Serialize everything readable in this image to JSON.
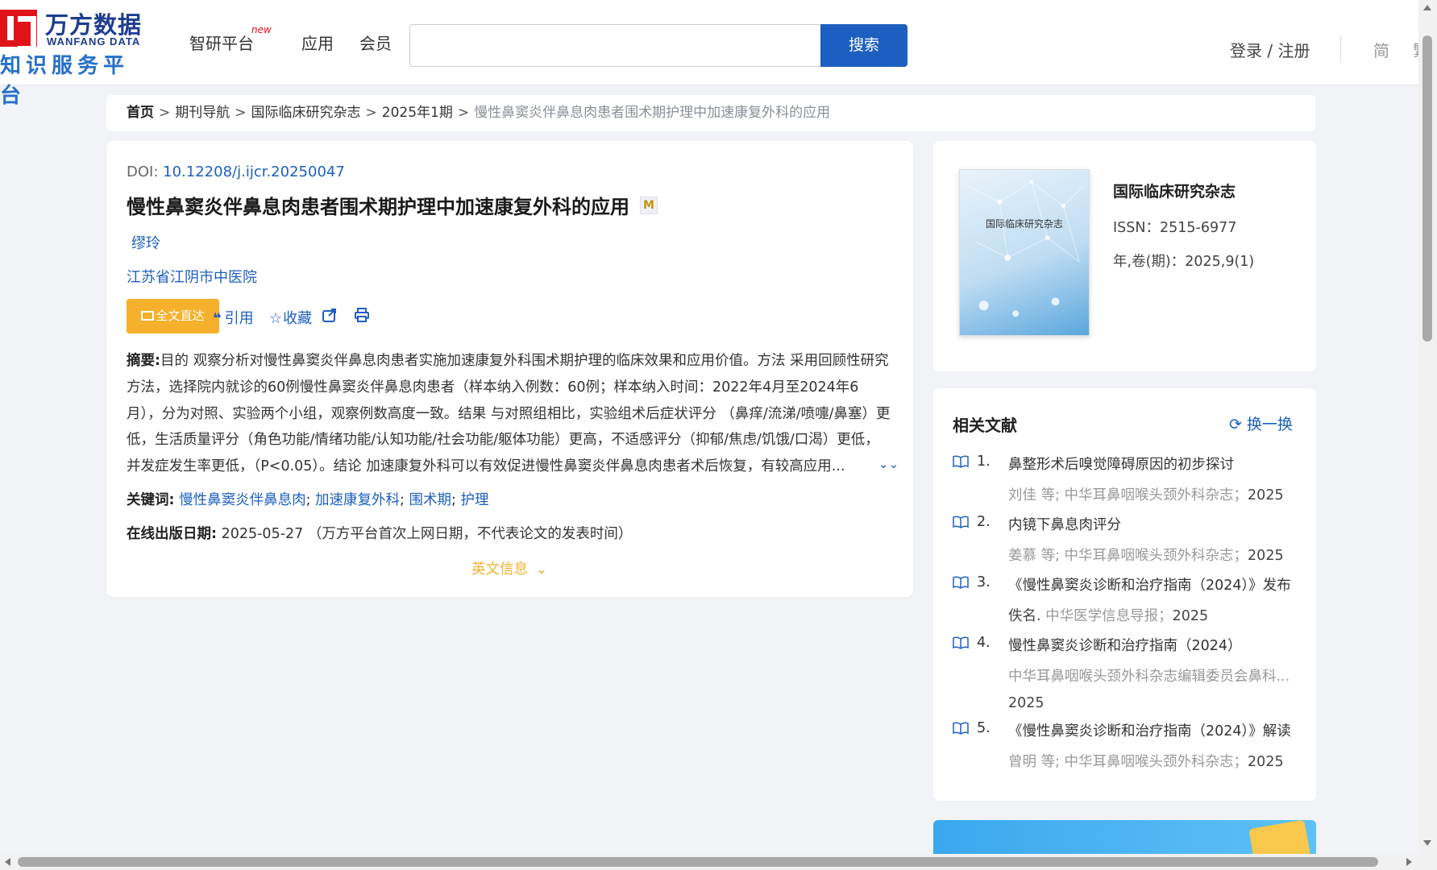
{
  "header": {
    "logo_cn": "万方数据",
    "logo_en": "WANFANG DATA",
    "logo_sub": "知识服务平台",
    "nav": [
      "智研平台",
      "应用",
      "会员"
    ],
    "nav_new_badge": "new",
    "search_placeholder": "",
    "search_button": "搜索",
    "login": "登录 / 注册",
    "lang_simplified": "简",
    "lang_traditional": "繁"
  },
  "breadcrumb": {
    "items": [
      "首页",
      "期刊导航",
      "国际临床研究杂志",
      "2025年1期"
    ],
    "separator": ">",
    "current": "慢性鼻窦炎伴鼻息肉患者围术期护理中加速康复外科的应用"
  },
  "article": {
    "doi_label": "DOI:",
    "doi": "10.12208/j.ijcr.20250047",
    "title": "慢性鼻窦炎伴鼻息肉患者围术期护理中加速康复外科的应用",
    "m_badge": "M",
    "author": "缪玲",
    "organization": "江苏省江阴市中医院",
    "fulltext_button": "全文直达",
    "actions": {
      "cite": "引用",
      "favorite": "收藏"
    },
    "abstract_label": "摘要:",
    "abstract": "目的 观察分析对慢性鼻窦炎伴鼻息肉患者实施加速康复外科围术期护理的临床效果和应用价值。方法 采用回顾性研究方法，选择院内就诊的60例慢性鼻窦炎伴鼻息肉患者（样本纳入例数：60例；样本纳入时间：2022年4月至2024年6月），分为对照、实验两个小组，观察例数高度一致。结果 与对照组相比，实验组术后症状评分 （鼻痒/流涕/喷嚏/鼻塞）更低，生活质量评分（角色功能/情绪功能/认知功能/社会功能/躯体功能）更高，不适感评分（抑郁/焦虑/饥饿/口渴）更低，并发症发生率更低，（P<0.05）。结论 加速康复外科可以有效促进慢性鼻窦炎伴鼻息肉患者术后恢复，有较高应用...",
    "keywords_label": "关键词:",
    "keywords": [
      "慢性鼻窦炎伴鼻息肉",
      "加速康复外科",
      "围术期",
      "护理"
    ],
    "pubdate_label": "在线出版日期:",
    "pubdate": "2025-05-27",
    "pubdate_note": "（万方平台首次上网日期，不代表论文的发表时间）",
    "english_info": "英文信息"
  },
  "journal": {
    "cover_title": "国际临床研究杂志",
    "name": "国际临床研究杂志",
    "issn": "ISSN：2515-6977",
    "volume": "年,卷(期)：2025,9(1)"
  },
  "related": {
    "title": "相关文献",
    "refresh": "换一换",
    "items": [
      {
        "num": "1.",
        "title": "鼻整形术后嗅觉障碍原因的初步探讨",
        "authors": "刘佳 等;",
        "source": "中华耳鼻咽喉头颈外科杂志；",
        "year": "2025"
      },
      {
        "num": "2.",
        "title": "内镜下鼻息肉评分",
        "authors": "姜慕 等;",
        "source": "中华耳鼻咽喉头颈外科杂志；",
        "year": "2025"
      },
      {
        "num": "3.",
        "title": "《慢性鼻窦炎诊断和治疗指南（2024）》发布",
        "authors": "佚名.",
        "source": "中华医学信息导报；",
        "year": "2025"
      },
      {
        "num": "4.",
        "title": "慢性鼻窦炎诊断和治疗指南（2024）",
        "authors": "",
        "source": "中华耳鼻咽喉头颈外科杂志编辑委员会鼻科...",
        "year": "2025"
      },
      {
        "num": "5.",
        "title": "《慢性鼻窦炎诊断和治疗指南（2024）》解读",
        "authors": "曾明 等;",
        "source": "中华耳鼻咽喉头颈外科杂志；",
        "year": "2025"
      }
    ]
  },
  "colors": {
    "accent": "#1d5fc0",
    "brand_red": "#e0121a",
    "orange": "#f5b12b",
    "background": "#f1f3f6"
  }
}
